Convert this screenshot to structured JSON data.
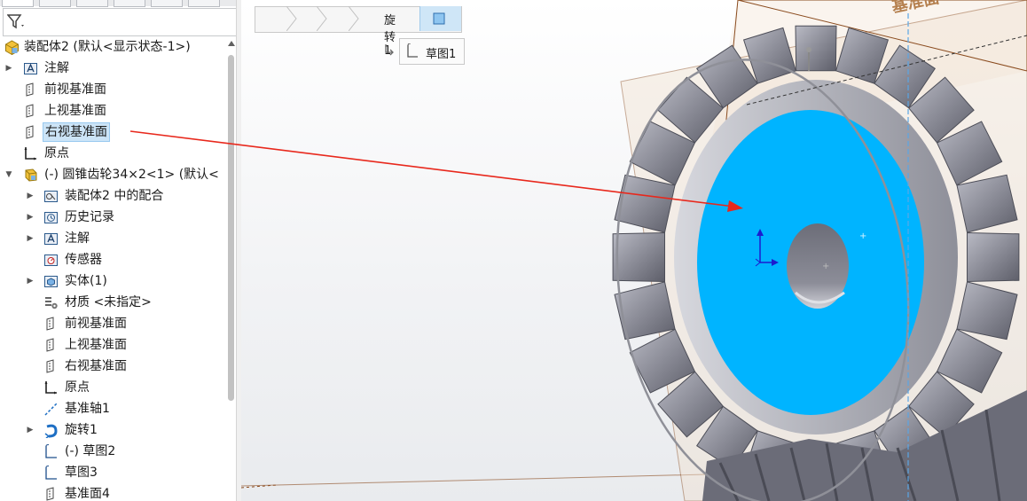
{
  "feature_tree": {
    "root": {
      "label": "装配体2  (默认<显示状态-1>)"
    },
    "items": [
      {
        "label": "注解",
        "icon": "annotation-icon",
        "level": 0,
        "expandable": true
      },
      {
        "label": "前视基准面",
        "icon": "plane-icon",
        "level": 0,
        "expandable": false
      },
      {
        "label": "上视基准面",
        "icon": "plane-icon",
        "level": 0,
        "expandable": false
      },
      {
        "label": "右视基准面",
        "icon": "plane-icon",
        "level": 0,
        "expandable": false,
        "selected": true
      },
      {
        "label": "原点",
        "icon": "origin-icon",
        "level": 0,
        "expandable": false
      },
      {
        "label": "(-) 圆锥齿轮34×2<1> (默认<",
        "icon": "part-icon",
        "level": 0,
        "expandable": true,
        "expanded": true
      },
      {
        "label": "装配体2 中的配合",
        "icon": "mates-icon",
        "level": 1,
        "expandable": true
      },
      {
        "label": "历史记录",
        "icon": "history-icon",
        "level": 1,
        "expandable": true
      },
      {
        "label": "注解",
        "icon": "annotation-icon",
        "level": 1,
        "expandable": true
      },
      {
        "label": "传感器",
        "icon": "sensor-icon",
        "level": 1,
        "expandable": false
      },
      {
        "label": "实体(1)",
        "icon": "solid-body-icon",
        "level": 1,
        "expandable": true
      },
      {
        "label": "材质 <未指定>",
        "icon": "material-icon",
        "level": 1,
        "expandable": false
      },
      {
        "label": "前视基准面",
        "icon": "plane-icon",
        "level": 1,
        "expandable": false
      },
      {
        "label": "上视基准面",
        "icon": "plane-icon",
        "level": 1,
        "expandable": false
      },
      {
        "label": "右视基准面",
        "icon": "plane-icon",
        "level": 1,
        "expandable": false
      },
      {
        "label": "原点",
        "icon": "origin-icon",
        "level": 1,
        "expandable": false
      },
      {
        "label": "基准轴1",
        "icon": "axis-icon",
        "level": 1,
        "expandable": false
      },
      {
        "label": "旋转1",
        "icon": "revolve-icon",
        "level": 1,
        "expandable": true
      },
      {
        "label": "(-) 草图2",
        "icon": "sketch-icon",
        "level": 1,
        "expandable": false
      },
      {
        "label": "草图3",
        "icon": "sketch-icon",
        "level": 1,
        "expandable": false
      },
      {
        "label": "基准面4",
        "icon": "plane-icon",
        "level": 1,
        "expandable": false
      }
    ]
  },
  "breadcrumb": {
    "items": [
      {
        "icon": "assembly-icon"
      },
      {
        "icon": "part-icon"
      },
      {
        "icon": "solid-body-icon"
      },
      {
        "icon": "revolve-icon",
        "label": "旋转1"
      },
      {
        "icon": "face-icon"
      }
    ],
    "sub_item": {
      "icon": "sketch-icon",
      "label": "草图1"
    }
  },
  "viewport": {
    "plane_label": "基准面",
    "colors": {
      "selected_face": "#00b4ff",
      "gear": "#8c8d96",
      "plane_edge": "#8a4b1e",
      "arrow": "#e8281c"
    }
  }
}
